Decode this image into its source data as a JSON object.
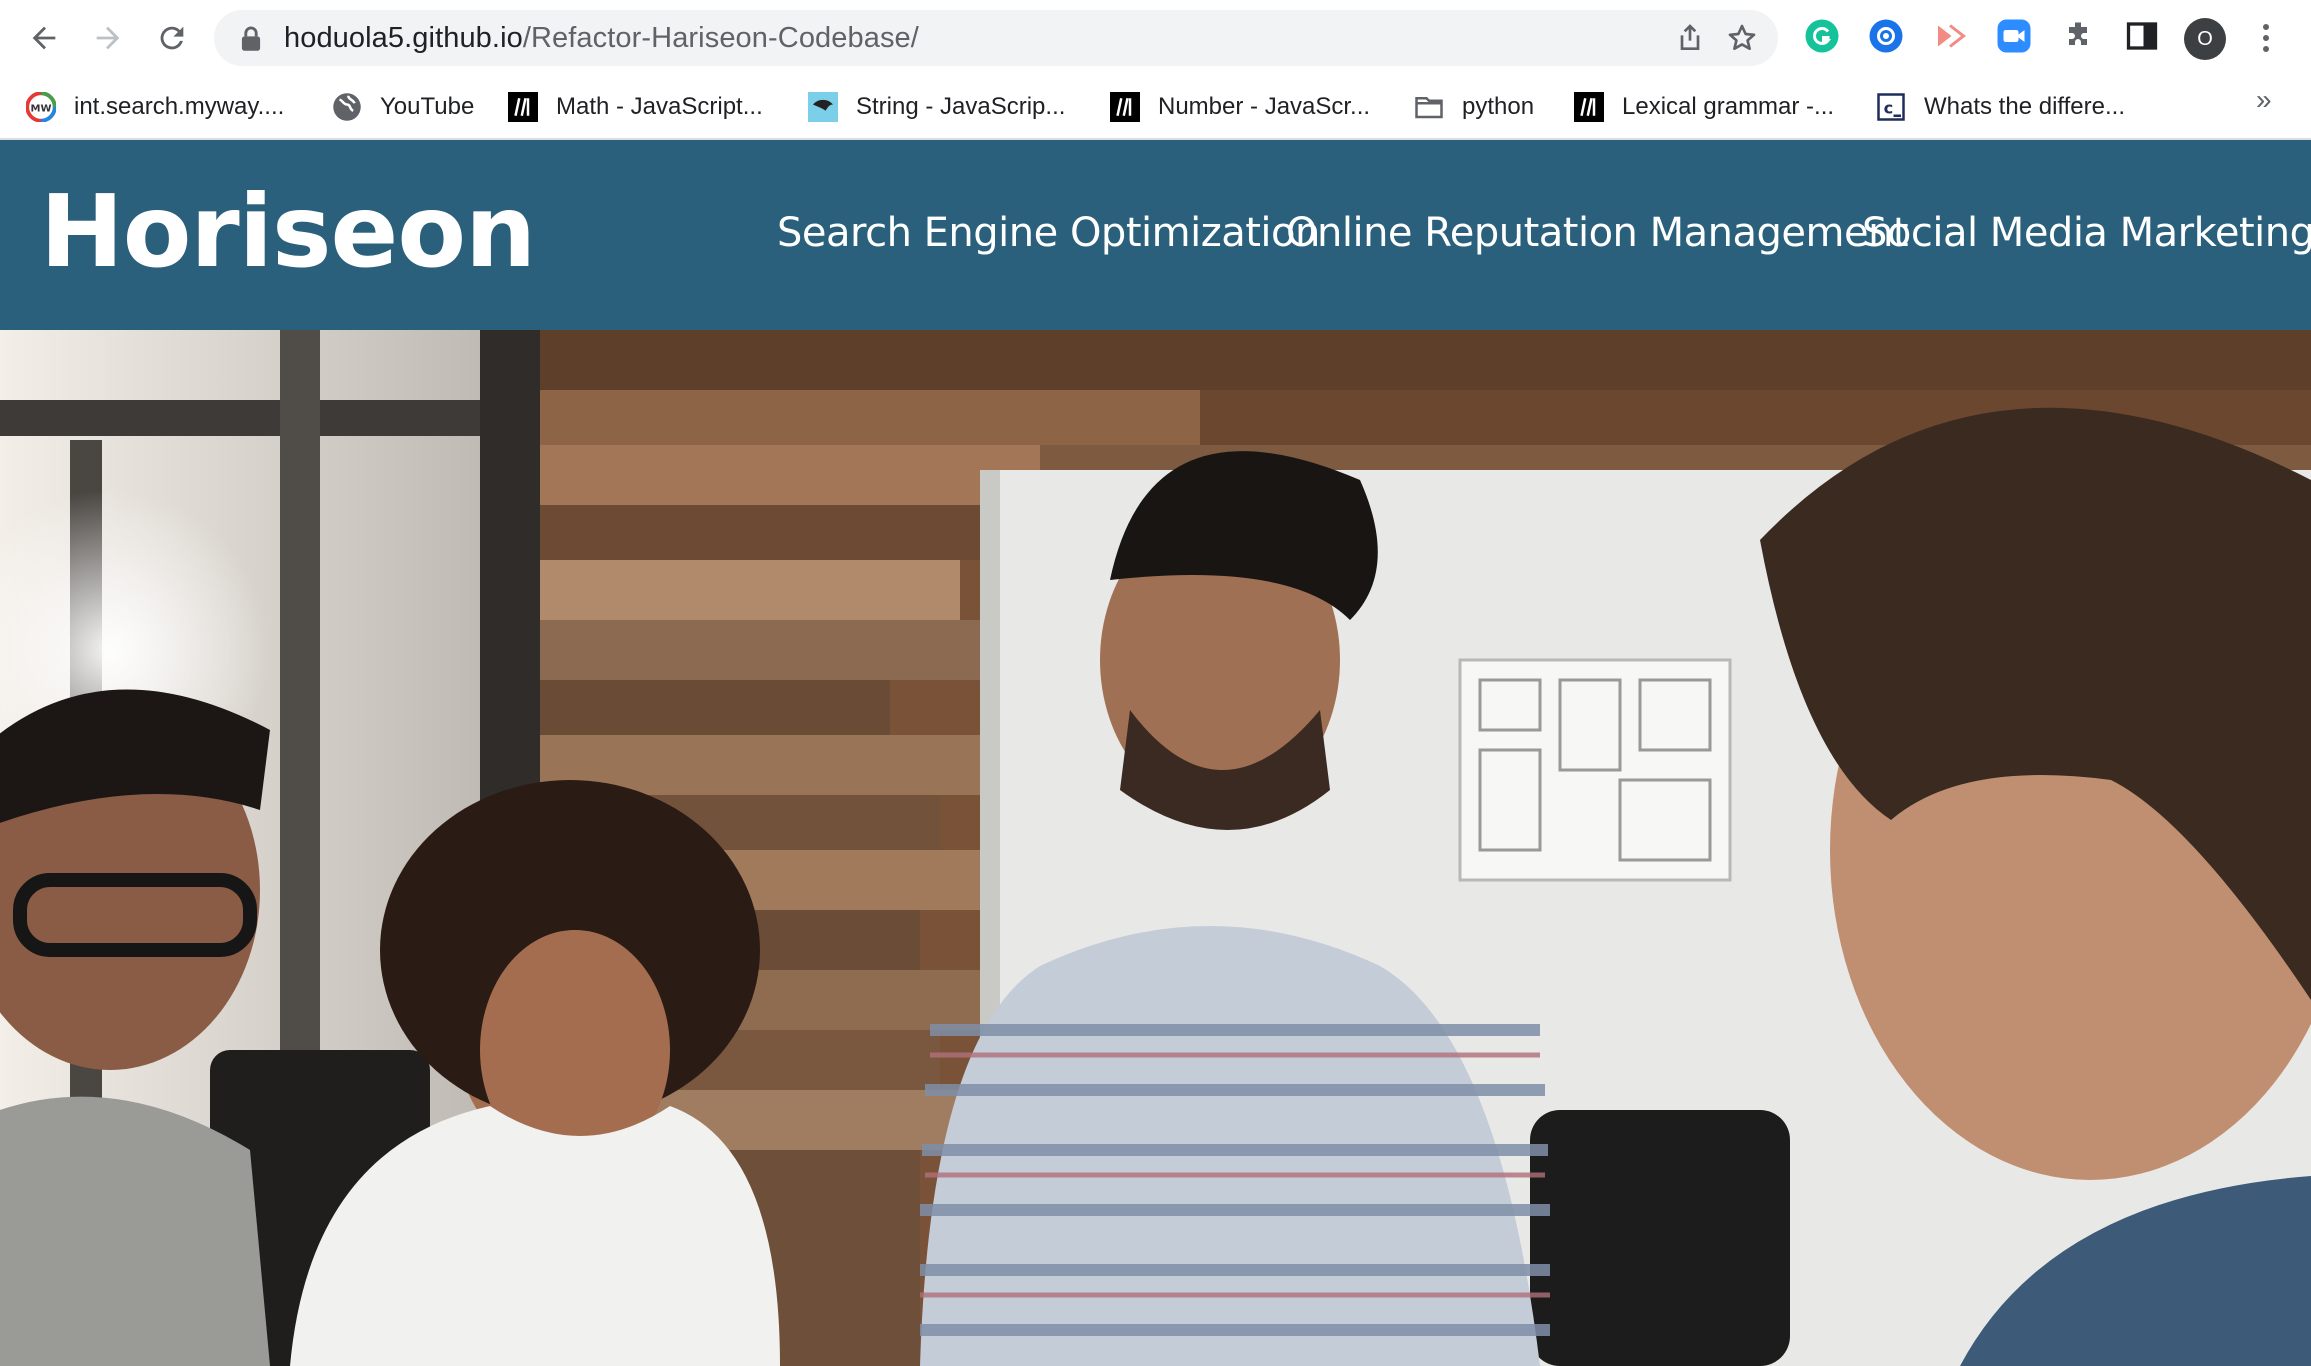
{
  "browser": {
    "url_host": "hoduola5.github.io",
    "url_path": "/Refactor-Hariseon-Codebase/",
    "profile_initial": "O",
    "bookmarks": [
      {
        "label": "int.search.myway....",
        "icon": "myway-icon"
      },
      {
        "label": "YouTube",
        "icon": "globe-icon"
      },
      {
        "label": "Math - JavaScript...",
        "icon": "mdn-icon"
      },
      {
        "label": "String - JavaScrip...",
        "icon": "js-bird-icon"
      },
      {
        "label": "Number - JavaScr...",
        "icon": "mdn-icon"
      },
      {
        "label": "python",
        "icon": "folder-icon"
      },
      {
        "label": "Lexical grammar -...",
        "icon": "mdn-icon"
      },
      {
        "label": "Whats the differe...",
        "icon": "codecademy-icon"
      }
    ],
    "bookmarks_overflow": "»",
    "extensions": [
      "grammarly-icon",
      "vpn-icon",
      "screencast-icon",
      "zoom-icon",
      "puzzle-extensions-icon",
      "side-panel-icon"
    ]
  },
  "site": {
    "logo": "Horiseon",
    "nav": [
      {
        "label": "Search Engine Optimization"
      },
      {
        "label": "Online Reputation Management"
      },
      {
        "label": "Social Media Marketing"
      }
    ],
    "header_color": "#2a607c",
    "hero_alt": "hero-image"
  }
}
